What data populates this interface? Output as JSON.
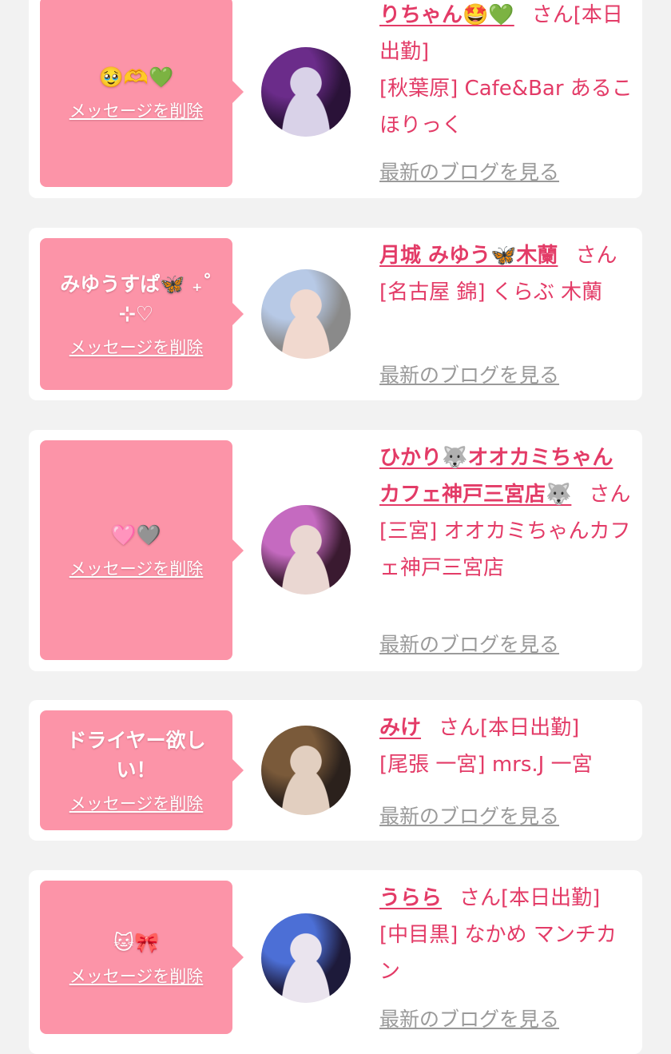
{
  "cards": [
    {
      "message": "🥹🫶💚",
      "delete_label": "メッセージを削除",
      "name": "りちゃん🤩💚",
      "suffix": "さん[本日出勤]",
      "shop": "[秋葉原] Cafe&Bar あるこほりっく",
      "blog_label": "最新のブログを見る",
      "avatar_colors": [
        "#2a1238",
        "#6b2c8a",
        "#d9d2e8"
      ]
    },
    {
      "message": "みゆうすぱ🦋 ₊˚⊹♡",
      "delete_label": "メッセージを削除",
      "name": "月城 みゆう🦋木蘭",
      "suffix": "さん",
      "shop": "[名古屋 錦] くらぶ 木蘭",
      "blog_label": "最新のブログを見る",
      "avatar_colors": [
        "#8a8a8a",
        "#b7c9e6",
        "#f1d9cf"
      ]
    },
    {
      "message": "🩷🩶",
      "delete_label": "メッセージを削除",
      "name": "ひかり🐺オオカミちゃんカフェ神戸三宮店🐺",
      "suffix": "さん",
      "shop": "[三宮] オオカミちゃんカフェ神戸三宮店",
      "blog_label": "最新のブログを見る",
      "avatar_colors": [
        "#3a1a30",
        "#c56ac0",
        "#ead7d2"
      ]
    },
    {
      "message": "ドライヤー欲しい！",
      "delete_label": "メッセージを削除",
      "name": "みけ",
      "suffix": "さん[本日出勤]",
      "shop": "[尾張 一宮] mrs.J 一宮",
      "blog_label": "最新のブログを見る",
      "avatar_colors": [
        "#2b211c",
        "#7a5a3a",
        "#e2cfc0"
      ]
    },
    {
      "message": "🐱🎀",
      "delete_label": "メッセージを削除",
      "name": "うらら",
      "suffix": "さん[本日出勤]",
      "shop": "[中目黒] なかめ マンチカン",
      "blog_label": "最新のブログを見る",
      "avatar_colors": [
        "#1d1a3a",
        "#4c6fd6",
        "#eae4ee"
      ]
    }
  ]
}
